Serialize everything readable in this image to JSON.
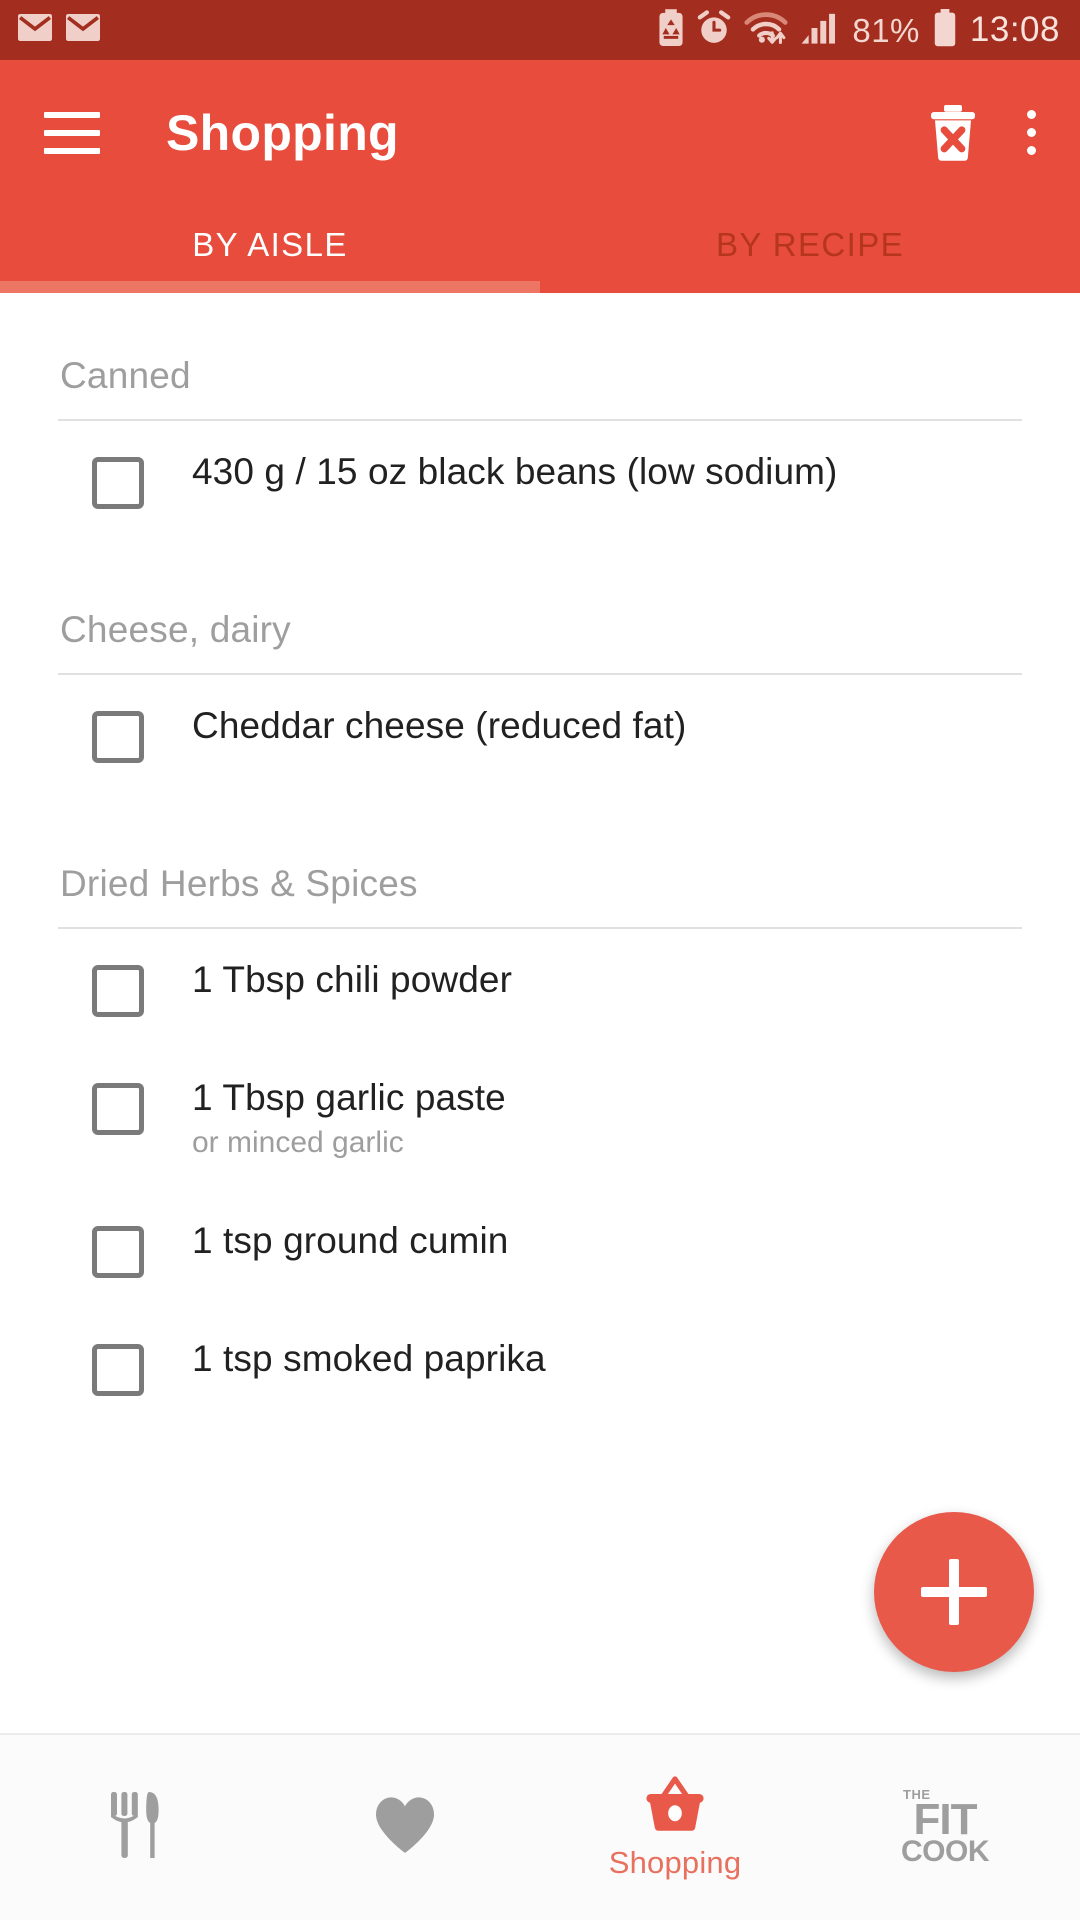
{
  "status_bar": {
    "icons": [
      "mail-icon",
      "mail-icon",
      "battery-saver-icon",
      "alarm-icon",
      "wifi-icon",
      "signal-icon"
    ],
    "battery_percent": "81%",
    "time": "13:08"
  },
  "app_bar": {
    "title": "Shopping",
    "menu_icon": "hamburger-menu-icon",
    "delete_icon": "delete-list-icon",
    "overflow_icon": "overflow-menu-icon"
  },
  "tabs": [
    {
      "label": "BY AISLE",
      "active": true
    },
    {
      "label": "BY RECIPE",
      "active": false
    }
  ],
  "sections": [
    {
      "title": "Canned",
      "items": [
        {
          "label": "430 g / 15 oz black beans (low sodium)",
          "sub": "",
          "checked": false
        }
      ]
    },
    {
      "title": "Cheese, dairy",
      "items": [
        {
          "label": "Cheddar cheese (reduced fat)",
          "sub": "",
          "checked": false
        }
      ]
    },
    {
      "title": "Dried Herbs & Spices",
      "items": [
        {
          "label": "1 Tbsp chili powder",
          "sub": "",
          "checked": false
        },
        {
          "label": "1 Tbsp garlic paste",
          "sub": "or minced garlic",
          "checked": false
        },
        {
          "label": "1 tsp ground cumin",
          "sub": "",
          "checked": false
        },
        {
          "label": "1 tsp smoked paprika",
          "sub": "",
          "checked": false
        }
      ]
    }
  ],
  "fab": {
    "icon": "add-icon",
    "label": ""
  },
  "bottom_nav": [
    {
      "icon": "fork-knife-icon",
      "label": "",
      "active": false
    },
    {
      "icon": "heart-icon",
      "label": "",
      "active": false
    },
    {
      "icon": "shopping-basket-icon",
      "label": "Shopping",
      "active": true
    },
    {
      "icon": "fit-cook-logo-icon",
      "label": "",
      "active": false,
      "logo_the": "THE",
      "logo_fit": "FIT",
      "logo_cook": "COOK"
    }
  ],
  "colors": {
    "status_bar": "#a32d1e",
    "app_bar": "#e74c3c",
    "accent": "#e8594a",
    "tab_inactive": "#b5351f",
    "tab_indicator": "#ed7564",
    "section_title": "#9e9e9e",
    "item_text": "#212121",
    "checkbox_border": "#7a7a7a"
  }
}
